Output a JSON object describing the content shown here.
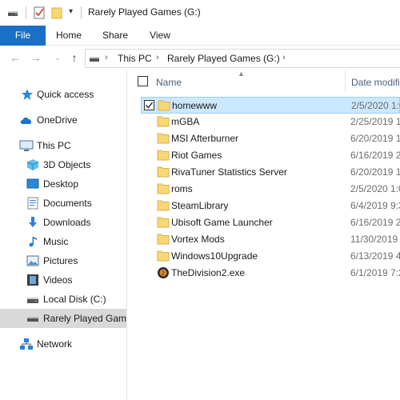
{
  "window": {
    "title": "Rarely Played Games (G:)"
  },
  "quick_access_toolbar": {
    "items": [
      "drive-icon",
      "properties-icon",
      "new-folder-icon",
      "customize-dropdown"
    ]
  },
  "ribbon": {
    "tabs": [
      "File",
      "Home",
      "Share",
      "View"
    ]
  },
  "address": {
    "crumbs": [
      "This PC",
      "Rarely Played Games (G:)"
    ]
  },
  "nav_pane": {
    "items": [
      {
        "label": "Quick access",
        "icon": "star-icon"
      },
      {
        "label": "OneDrive",
        "icon": "cloud-icon"
      },
      {
        "label": "This PC",
        "icon": "computer-icon"
      },
      {
        "label": "3D Objects",
        "icon": "cube-icon"
      },
      {
        "label": "Desktop",
        "icon": "desktop-icon"
      },
      {
        "label": "Documents",
        "icon": "document-icon"
      },
      {
        "label": "Downloads",
        "icon": "download-icon"
      },
      {
        "label": "Music",
        "icon": "music-icon"
      },
      {
        "label": "Pictures",
        "icon": "picture-icon"
      },
      {
        "label": "Videos",
        "icon": "video-icon"
      },
      {
        "label": "Local Disk (C:)",
        "icon": "drive-icon"
      },
      {
        "label": "Rarely Played Game",
        "icon": "drive-icon"
      },
      {
        "label": "Network",
        "icon": "network-icon"
      }
    ]
  },
  "file_list": {
    "columns": {
      "name": "Name",
      "date": "Date modifi"
    },
    "rows": [
      {
        "name": "homewww",
        "date": "2/5/2020 1:0",
        "type": "folder",
        "selected": true
      },
      {
        "name": "mGBA",
        "date": "2/25/2019 1:",
        "type": "folder"
      },
      {
        "name": "MSI Afterburner",
        "date": "6/20/2019 1:",
        "type": "folder"
      },
      {
        "name": "Riot Games",
        "date": "6/16/2019 2:",
        "type": "folder"
      },
      {
        "name": "RivaTuner Statistics Server",
        "date": "6/20/2019 1:",
        "type": "folder"
      },
      {
        "name": "roms",
        "date": "2/5/2020 1:0",
        "type": "folder"
      },
      {
        "name": "SteamLibrary",
        "date": "6/4/2019 9:3",
        "type": "folder"
      },
      {
        "name": "Ubisoft Game Launcher",
        "date": "6/16/2019 2:",
        "type": "folder"
      },
      {
        "name": "Vortex Mods",
        "date": "11/30/2019",
        "type": "folder"
      },
      {
        "name": "Windows10Upgrade",
        "date": "6/13/2019 4:",
        "type": "folder"
      },
      {
        "name": "TheDivision2.exe",
        "date": "6/1/2019 7:2",
        "type": "exe"
      }
    ]
  },
  "colors": {
    "accent": "#1a6fc6",
    "selection_bg": "#cce8ff",
    "selection_border": "#99d1ff",
    "folder": "#f8d775",
    "header_text": "#4c607a"
  }
}
